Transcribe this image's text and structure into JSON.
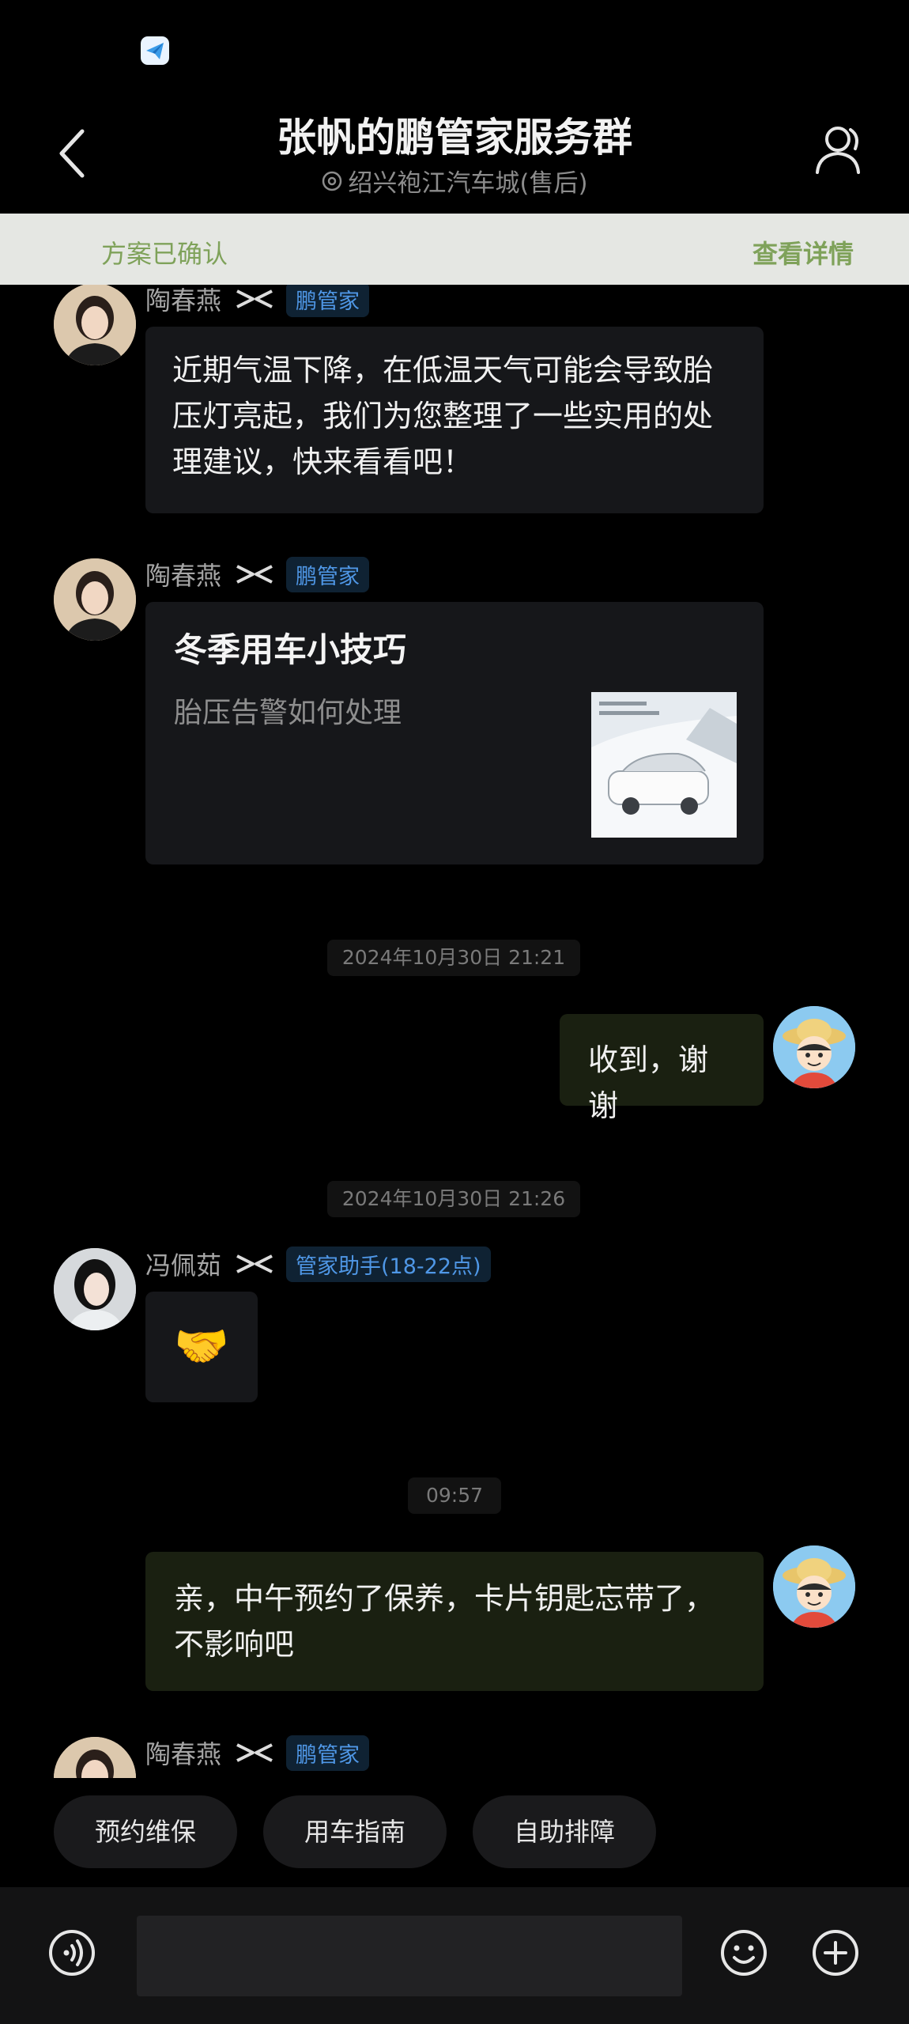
{
  "header": {
    "title": "张帆的鹏管家服务群",
    "subtitle": "绍兴袍江汽车城(售后)"
  },
  "notice": {
    "status": "方案已确认",
    "action": "查看详情"
  },
  "messages": [
    {
      "sender": "陶春燕",
      "tag": "鹏管家",
      "text": "近期气温下降，在低温天气可能会导致胎\n压灯亮起，我们为您整理了一些实用的处\n理建议，快来看看吧！"
    },
    {
      "sender": "陶春燕",
      "tag": "鹏管家",
      "card_title": "冬季用车小技巧",
      "card_subtitle": "胎压告警如何处理"
    },
    {
      "timestamp": "2024年10月30日 21:21"
    },
    {
      "text": "收到，谢谢"
    },
    {
      "timestamp": "2024年10月30日 21:26"
    },
    {
      "sender": "冯佩茹",
      "tag": "管家助手(18-22点)",
      "emoji": "🤝"
    },
    {
      "timestamp": "09:57"
    },
    {
      "text": "亲，中午预约了保养，卡片钥匙忘带了，\n不影响吧"
    },
    {
      "sender": "陶春燕",
      "tag": "鹏管家"
    }
  ],
  "quick_replies": [
    "预约维保",
    "用车指南",
    "自助排障"
  ],
  "input": {
    "value": "",
    "placeholder": ""
  },
  "colors": {
    "background": "#000000",
    "my_bubble": "#1a2011",
    "other_bubble": "#16171a",
    "tag_text": "#4f97e6",
    "notice_text": "#7fa25a"
  },
  "icons": [
    "back-arrow-icon",
    "location-pin-icon",
    "group-members-icon",
    "xpeng-logo-icon",
    "voice-icon",
    "emoji-icon",
    "plus-icon"
  ]
}
